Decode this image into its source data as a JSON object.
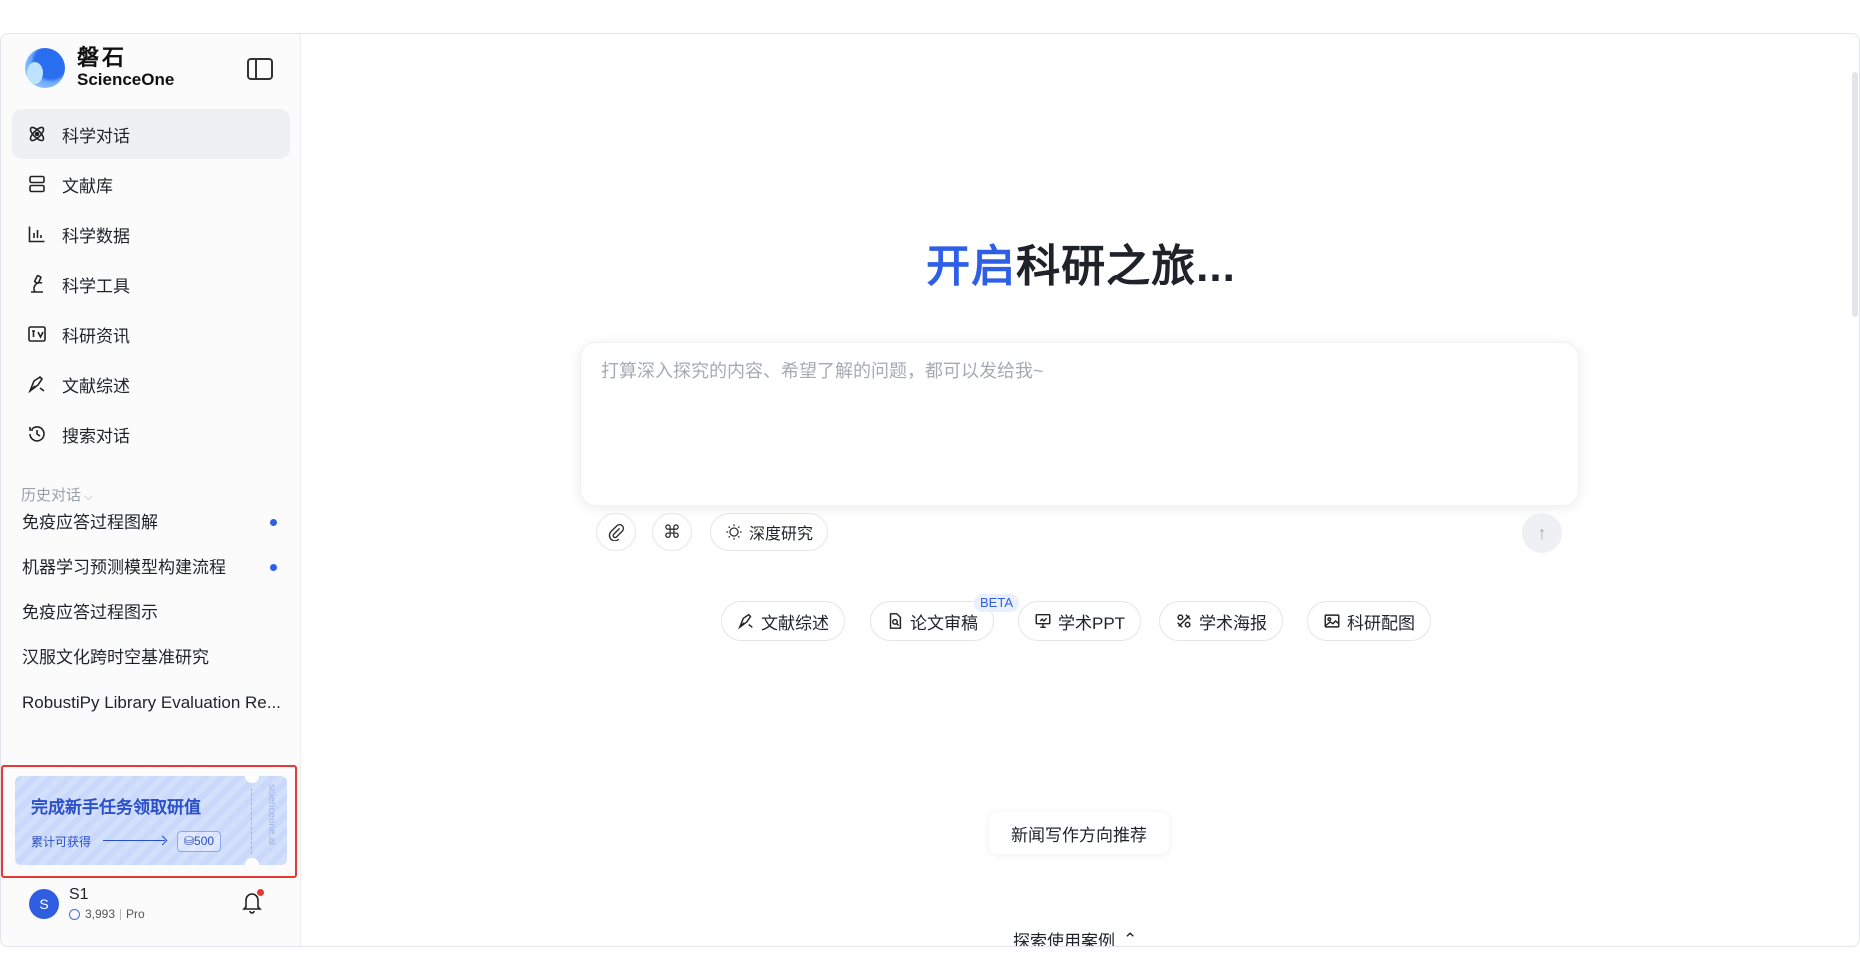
{
  "brand": {
    "name_cn": "磐石",
    "name_en": "ScienceOne"
  },
  "nav": [
    {
      "label": "科学对话",
      "icon": "atom-icon",
      "active": true
    },
    {
      "label": "文献库",
      "icon": "library-icon"
    },
    {
      "label": "科学数据",
      "icon": "data-chart-icon"
    },
    {
      "label": "科学工具",
      "icon": "microscope-icon"
    },
    {
      "label": "科研资讯",
      "icon": "news-icon"
    },
    {
      "label": "文献综述",
      "icon": "pen-nib-icon"
    },
    {
      "label": "搜索对话",
      "icon": "history-icon"
    }
  ],
  "history": {
    "header": "历史对话",
    "items": [
      {
        "label": "免疫应答过程图解",
        "unread": true
      },
      {
        "label": "机器学习预测模型构建流程",
        "unread": true
      },
      {
        "label": "免疫应答过程图示",
        "unread": false
      },
      {
        "label": "汉服文化跨时空基准研究",
        "unread": false
      },
      {
        "label": "RobustiPy Library Evaluation Re...",
        "unread": false
      }
    ]
  },
  "promo": {
    "title": "完成新手任务领取研值",
    "sub": "累计可获得",
    "badge": "⛁500",
    "vertical": "scienceone.ai"
  },
  "user": {
    "avatar": "S",
    "name": "S1",
    "credits": "3,993",
    "plan": "Pro"
  },
  "main": {
    "title_hl": "开启",
    "title_rest": "科研之旅...",
    "input_placeholder": "打算深入探究的内容、希望了解的问题，都可以发给我~",
    "deep_research": "深度研究",
    "quick_actions": [
      {
        "label": "文献综述",
        "icon": "pen-nib-icon"
      },
      {
        "label": "论文审稿",
        "icon": "doc-search-icon"
      },
      {
        "label": "学术PPT",
        "icon": "presentation-icon"
      },
      {
        "label": "学术海报",
        "icon": "poster-icon"
      },
      {
        "label": "科研配图",
        "icon": "image-icon"
      }
    ],
    "beta": "BETA",
    "suggestion": "新闻写作方向推荐",
    "explore": "探索使用案例"
  },
  "colors": {
    "accent": "#2e5fe6",
    "promo_border": "#e53935"
  }
}
